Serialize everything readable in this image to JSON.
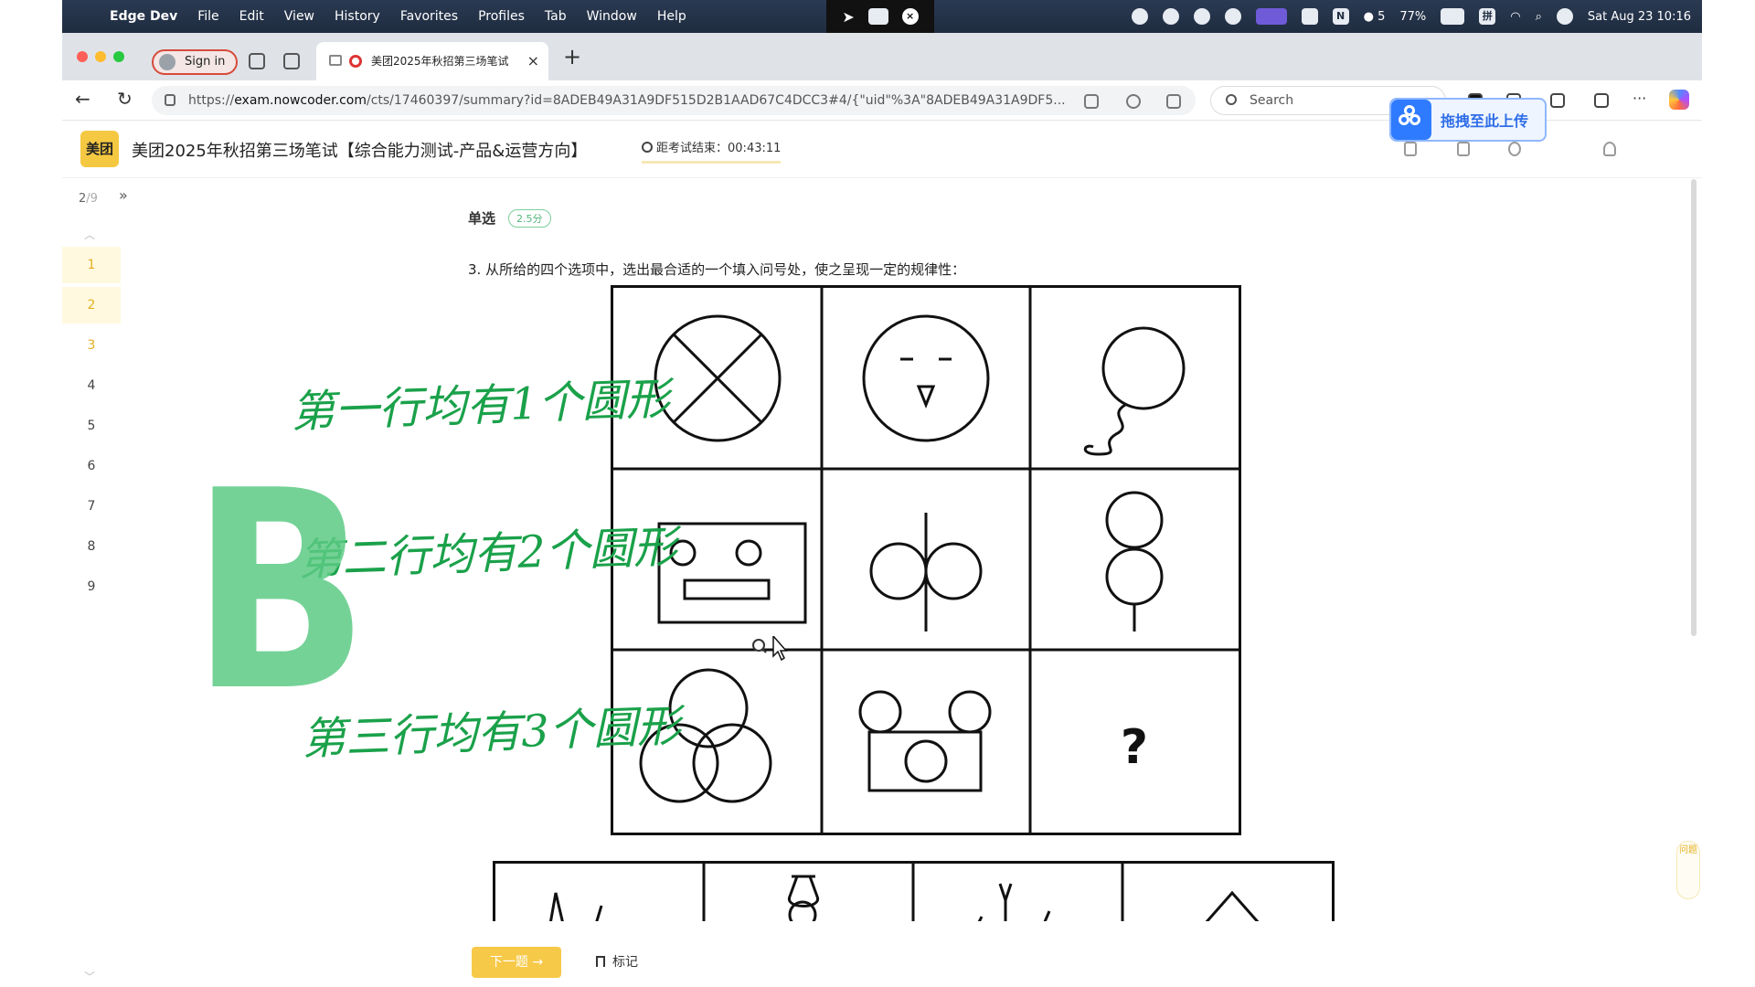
{
  "menubar": {
    "apple": "",
    "app_name": "Edge Dev",
    "items": [
      "File",
      "Edit",
      "View",
      "History",
      "Favorites",
      "Profiles",
      "Tab",
      "Window",
      "Help"
    ],
    "wechat_count": "5",
    "battery": "77%",
    "input_method": "拼",
    "datetime": "Sat Aug 23  10:16"
  },
  "browser": {
    "sign_in": "Sign in",
    "tab_title": "美团2025年秋招第三场笔试",
    "tab_close": "×",
    "new_tab": "+",
    "url_prefix": "https://",
    "url_host": "exam.nowcoder.com",
    "url_path": "/cts/17460397/summary?id=8ADEB49A31A9DF515D2B1AAD67C4DCC3#4/{\"uid\"%3A\"8ADEB49A31A9DF5...",
    "search_placeholder": "Search",
    "more": "···"
  },
  "upload_popup": {
    "label": "拖拽至此上传"
  },
  "header": {
    "brand": "美团",
    "title": "美团2025年秋招第三场笔试【综合能力测试-产品&运营方向】",
    "timer_label": "距考试结束：",
    "timer_value": "00:43:11"
  },
  "qnav": {
    "current": "2",
    "total": "/9",
    "expand": "»",
    "up": "︿",
    "down": "﹀",
    "numbers": [
      "1",
      "2",
      "3",
      "4",
      "5",
      "6",
      "7",
      "8",
      "9"
    ]
  },
  "question": {
    "type": "单选",
    "score": "2.5分",
    "text": "3. 从所给的四个选项中，选出最合适的一个填入问号处，使之呈现一定的规律性：",
    "question_mark": "?"
  },
  "annotations": {
    "line1": "第一行均有1个圆形",
    "line2": "第二行均有2个圆形",
    "line3": "第三行均有3个圆形",
    "answer": "B"
  },
  "footer": {
    "next": "下一题 →",
    "mark": "标记"
  },
  "float_tool": {
    "label": "问题"
  }
}
